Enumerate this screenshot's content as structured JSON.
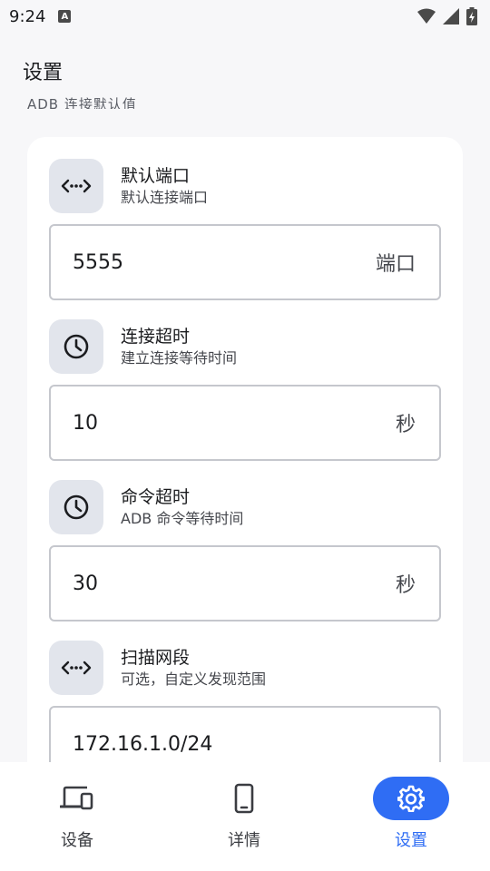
{
  "status_bar": {
    "time": "9:24",
    "notification_badge": "A"
  },
  "header": {
    "title": "设置",
    "section_label": "ADB 连接默认值"
  },
  "settings": [
    {
      "icon": "code-icon",
      "title": "默认端口",
      "subtitle": "默认连接端口",
      "value": "5555",
      "suffix": "端口"
    },
    {
      "icon": "clock-icon",
      "title": "连接超时",
      "subtitle": "建立连接等待时间",
      "value": "10",
      "suffix": "秒"
    },
    {
      "icon": "clock-icon",
      "title": "命令超时",
      "subtitle": "ADB 命令等待时间",
      "value": "30",
      "suffix": "秒"
    },
    {
      "icon": "code-icon",
      "title": "扫描网段",
      "subtitle": "可选，自定义发现范围",
      "value": "172.16.1.0/24",
      "suffix": ""
    }
  ],
  "bottom_nav": [
    {
      "label": "设备",
      "icon": "devices-icon",
      "active": false
    },
    {
      "label": "详情",
      "icon": "phone-icon",
      "active": false
    },
    {
      "label": "设置",
      "icon": "gear-icon",
      "active": true
    }
  ],
  "colors": {
    "accent": "#2f6df4",
    "icon_bg": "#e2e5ec",
    "background": "#f7f7f9",
    "card": "#ffffff"
  }
}
